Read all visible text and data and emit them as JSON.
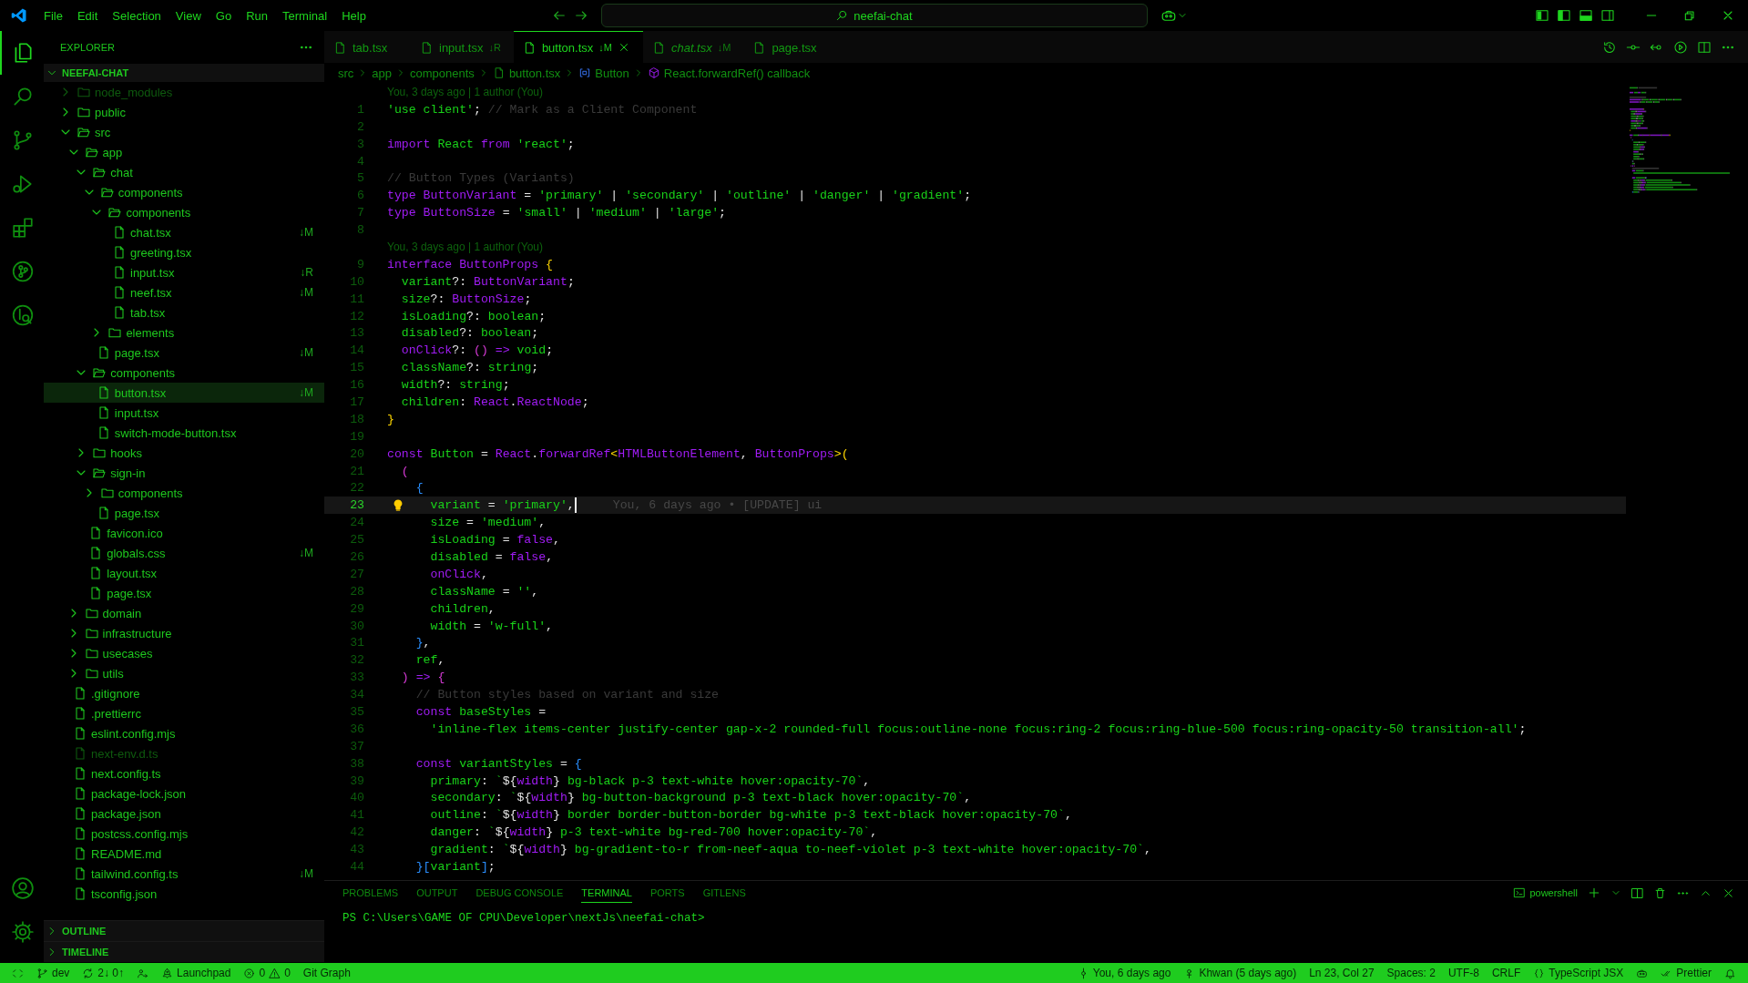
{
  "title_bar": {
    "menu": [
      "File",
      "Edit",
      "Selection",
      "View",
      "Go",
      "Run",
      "Terminal",
      "Help"
    ],
    "command_center": "neefai-chat"
  },
  "activity_bar": {
    "items": [
      {
        "kind": "explorer",
        "selected": true
      },
      {
        "kind": "search",
        "selected": false
      },
      {
        "kind": "source-control",
        "selected": false
      },
      {
        "kind": "run-debug",
        "selected": false
      },
      {
        "kind": "extensions",
        "selected": false
      },
      {
        "kind": "git-graph",
        "selected": false
      },
      {
        "kind": "inspect",
        "selected": false
      }
    ],
    "bottom": [
      {
        "kind": "account"
      },
      {
        "kind": "settings"
      }
    ]
  },
  "sidebar": {
    "title": "EXPLORER",
    "root": {
      "name": "NEEFAI-CHAT",
      "expanded": true,
      "children": [
        {
          "name": "node_modules",
          "kind": "folder",
          "expanded": false,
          "ignored": true,
          "selected": false
        },
        {
          "name": "public",
          "kind": "folder",
          "expanded": false,
          "ignored": false,
          "selected": false
        },
        {
          "name": "src",
          "kind": "folder",
          "expanded": true,
          "ignored": false,
          "selected": false,
          "children": [
            {
              "name": "app",
              "kind": "folder",
              "expanded": true,
              "ignored": false,
              "selected": false,
              "children": [
                {
                  "name": "chat",
                  "kind": "folder",
                  "expanded": true,
                  "ignored": false,
                  "selected": false,
                  "children": [
                    {
                      "name": "components",
                      "kind": "folder",
                      "expanded": true,
                      "ignored": false,
                      "selected": false,
                      "children": [
                        {
                          "name": "components",
                          "kind": "folder",
                          "expanded": true,
                          "ignored": false,
                          "selected": false,
                          "children": [
                            {
                              "name": "chat.tsx",
                              "kind": "file",
                              "ignored": false,
                              "selected": false,
                              "badge": "↓M"
                            },
                            {
                              "name": "greeting.tsx",
                              "kind": "file",
                              "ignored": false,
                              "selected": false
                            },
                            {
                              "name": "input.tsx",
                              "kind": "file",
                              "ignored": false,
                              "selected": false,
                              "badge": "↓R"
                            },
                            {
                              "name": "neef.tsx",
                              "kind": "file",
                              "ignored": false,
                              "selected": false,
                              "badge": "↓M"
                            },
                            {
                              "name": "tab.tsx",
                              "kind": "file",
                              "ignored": false,
                              "selected": false
                            }
                          ]
                        },
                        {
                          "name": "elements",
                          "kind": "folder",
                          "expanded": false,
                          "ignored": false,
                          "selected": false
                        }
                      ]
                    },
                    {
                      "name": "page.tsx",
                      "kind": "file",
                      "ignored": false,
                      "selected": false,
                      "badge": "↓M"
                    }
                  ]
                },
                {
                  "name": "components",
                  "kind": "folder",
                  "expanded": true,
                  "ignored": false,
                  "selected": false,
                  "children": [
                    {
                      "name": "button.tsx",
                      "kind": "file",
                      "ignored": false,
                      "selected": true,
                      "badge": "↓M"
                    },
                    {
                      "name": "input.tsx",
                      "kind": "file",
                      "ignored": false,
                      "selected": false
                    },
                    {
                      "name": "switch-mode-button.tsx",
                      "kind": "file",
                      "ignored": false,
                      "selected": false
                    }
                  ]
                },
                {
                  "name": "hooks",
                  "kind": "folder",
                  "expanded": false,
                  "ignored": false,
                  "selected": false
                },
                {
                  "name": "sign-in",
                  "kind": "folder",
                  "expanded": true,
                  "ignored": false,
                  "selected": false,
                  "children": [
                    {
                      "name": "components",
                      "kind": "folder",
                      "expanded": false,
                      "ignored": false,
                      "selected": false
                    },
                    {
                      "name": "page.tsx",
                      "kind": "file",
                      "ignored": false,
                      "selected": false
                    }
                  ]
                },
                {
                  "name": "favicon.ico",
                  "kind": "file",
                  "ignored": false,
                  "selected": false
                },
                {
                  "name": "globals.css",
                  "kind": "file",
                  "ignored": false,
                  "selected": false,
                  "badge": "↓M"
                },
                {
                  "name": "layout.tsx",
                  "kind": "file",
                  "ignored": false,
                  "selected": false
                },
                {
                  "name": "page.tsx",
                  "kind": "file",
                  "ignored": false,
                  "selected": false
                }
              ]
            },
            {
              "name": "domain",
              "kind": "folder",
              "expanded": false,
              "ignored": false,
              "selected": false
            },
            {
              "name": "infrastructure",
              "kind": "folder",
              "expanded": false,
              "ignored": false,
              "selected": false
            },
            {
              "name": "usecases",
              "kind": "folder",
              "expanded": false,
              "ignored": false,
              "selected": false
            },
            {
              "name": "utils",
              "kind": "folder",
              "expanded": false,
              "ignored": false,
              "selected": false
            }
          ]
        },
        {
          "name": ".gitignore",
          "kind": "file",
          "ignored": false,
          "selected": false
        },
        {
          "name": ".prettierrc",
          "kind": "file",
          "ignored": false,
          "selected": false
        },
        {
          "name": "eslint.config.mjs",
          "kind": "file",
          "ignored": false,
          "selected": false
        },
        {
          "name": "next-env.d.ts",
          "kind": "file",
          "ignored": true,
          "selected": false
        },
        {
          "name": "next.config.ts",
          "kind": "file",
          "ignored": false,
          "selected": false
        },
        {
          "name": "package-lock.json",
          "kind": "file",
          "ignored": false,
          "selected": false
        },
        {
          "name": "package.json",
          "kind": "file",
          "ignored": false,
          "selected": false
        },
        {
          "name": "postcss.config.mjs",
          "kind": "file",
          "ignored": false,
          "selected": false
        },
        {
          "name": "README.md",
          "kind": "file",
          "ignored": false,
          "selected": false
        },
        {
          "name": "tailwind.config.ts",
          "kind": "file",
          "ignored": false,
          "selected": false,
          "badge": "↓M"
        },
        {
          "name": "tsconfig.json",
          "kind": "file",
          "ignored": false,
          "selected": false
        }
      ]
    },
    "sections": [
      {
        "name": "OUTLINE",
        "expanded": false
      },
      {
        "name": "TIMELINE",
        "expanded": false
      }
    ]
  },
  "tabs": [
    {
      "label": "tab.tsx",
      "selected": false,
      "preview": false
    },
    {
      "label": "input.tsx",
      "selected": false,
      "preview": false,
      "badge": "↓R"
    },
    {
      "label": "button.tsx",
      "selected": true,
      "preview": false,
      "badge": "↓M"
    },
    {
      "label": "chat.tsx",
      "selected": false,
      "preview": true,
      "badge": "↓M"
    },
    {
      "label": "page.tsx",
      "selected": false,
      "preview": false
    }
  ],
  "breadcrumbs": [
    {
      "label": "src",
      "kind": "folder"
    },
    {
      "label": "app",
      "kind": "folder"
    },
    {
      "label": "components",
      "kind": "folder"
    },
    {
      "label": "button.tsx",
      "kind": "file"
    },
    {
      "label": "Button",
      "kind": "variable"
    },
    {
      "label": "React.forwardRef() callback",
      "kind": "method"
    }
  ],
  "editor": {
    "lines": [
      {
        "kind": "lens",
        "text": "You, 3 days ago | 1 author (You)"
      },
      {
        "kind": "code",
        "number": "1",
        "current": false,
        "tokens": [
          {
            "kind": "s",
            "text": "'use client'"
          },
          {
            "kind": "p",
            "text": ";"
          },
          {
            "kind": "c",
            "text": " // Mark as a Client Component"
          }
        ]
      },
      {
        "kind": "code",
        "number": "2",
        "current": false
      },
      {
        "kind": "code",
        "number": "3",
        "current": false,
        "tokens": [
          {
            "kind": "k",
            "text": "import"
          },
          {
            "kind": "t",
            "text": " React "
          },
          {
            "kind": "k",
            "text": "from"
          },
          {
            "kind": "s",
            "text": " 'react'"
          },
          {
            "kind": "p",
            "text": ";"
          }
        ]
      },
      {
        "kind": "code",
        "number": "4",
        "current": false
      },
      {
        "kind": "code",
        "number": "5",
        "current": false,
        "tokens": [
          {
            "kind": "c",
            "text": "// Button Types (Variants)"
          }
        ]
      },
      {
        "kind": "code",
        "number": "6",
        "current": false,
        "tokens": [
          {
            "kind": "k",
            "text": "type ButtonVariant"
          },
          {
            "kind": "p",
            "text": " = "
          },
          {
            "kind": "s",
            "text": "'primary'"
          },
          {
            "kind": "p",
            "text": " | "
          },
          {
            "kind": "s",
            "text": "'secondary'"
          },
          {
            "kind": "p",
            "text": " | "
          },
          {
            "kind": "s",
            "text": "'outline'"
          },
          {
            "kind": "p",
            "text": " | "
          },
          {
            "kind": "s",
            "text": "'danger'"
          },
          {
            "kind": "p",
            "text": " | "
          },
          {
            "kind": "s",
            "text": "'gradient'"
          },
          {
            "kind": "p",
            "text": ";"
          }
        ]
      },
      {
        "kind": "code",
        "number": "7",
        "current": false,
        "tokens": [
          {
            "kind": "k",
            "text": "type ButtonSize"
          },
          {
            "kind": "p",
            "text": " = "
          },
          {
            "kind": "s",
            "text": "'small'"
          },
          {
            "kind": "p",
            "text": " | "
          },
          {
            "kind": "s",
            "text": "'medium'"
          },
          {
            "kind": "p",
            "text": " | "
          },
          {
            "kind": "s",
            "text": "'large'"
          },
          {
            "kind": "p",
            "text": ";"
          }
        ]
      },
      {
        "kind": "code",
        "number": "8",
        "current": false
      },
      {
        "kind": "lens",
        "text": "You, 3 days ago | 1 author (You)"
      },
      {
        "kind": "code",
        "number": "9",
        "current": false,
        "tokens": [
          {
            "kind": "k",
            "text": "interface ButtonProps "
          },
          {
            "kind": "y",
            "text": "{"
          }
        ]
      },
      {
        "kind": "code",
        "number": "10",
        "current": false,
        "tokens": [
          {
            "kind": "t",
            "text": "  variant"
          },
          {
            "kind": "p",
            "text": "?: "
          },
          {
            "kind": "k",
            "text": "ButtonVariant"
          },
          {
            "kind": "p",
            "text": ";"
          }
        ]
      },
      {
        "kind": "code",
        "number": "11",
        "current": false,
        "tokens": [
          {
            "kind": "t",
            "text": "  size"
          },
          {
            "kind": "p",
            "text": "?: "
          },
          {
            "kind": "k",
            "text": "ButtonSize"
          },
          {
            "kind": "p",
            "text": ";"
          }
        ]
      },
      {
        "kind": "code",
        "number": "12",
        "current": false,
        "tokens": [
          {
            "kind": "t",
            "text": "  isLoading"
          },
          {
            "kind": "p",
            "text": "?: "
          },
          {
            "kind": "t",
            "text": "boolean"
          },
          {
            "kind": "p",
            "text": ";"
          }
        ]
      },
      {
        "kind": "code",
        "number": "13",
        "current": false,
        "tokens": [
          {
            "kind": "t",
            "text": "  disabled"
          },
          {
            "kind": "p",
            "text": "?: "
          },
          {
            "kind": "t",
            "text": "boolean"
          },
          {
            "kind": "p",
            "text": ";"
          }
        ]
      },
      {
        "kind": "code",
        "number": "14",
        "current": false,
        "tokens": [
          {
            "kind": "k",
            "text": "  onClick"
          },
          {
            "kind": "p",
            "text": "?: "
          },
          {
            "kind": "m",
            "text": "()"
          },
          {
            "kind": "k",
            "text": " =>"
          },
          {
            "kind": "t",
            "text": " void"
          },
          {
            "kind": "p",
            "text": ";"
          }
        ]
      },
      {
        "kind": "code",
        "number": "15",
        "current": false,
        "tokens": [
          {
            "kind": "t",
            "text": "  className"
          },
          {
            "kind": "p",
            "text": "?: "
          },
          {
            "kind": "t",
            "text": "string"
          },
          {
            "kind": "p",
            "text": ";"
          }
        ]
      },
      {
        "kind": "code",
        "number": "16",
        "current": false,
        "tokens": [
          {
            "kind": "t",
            "text": "  width"
          },
          {
            "kind": "p",
            "text": "?: "
          },
          {
            "kind": "t",
            "text": "string"
          },
          {
            "kind": "p",
            "text": ";"
          }
        ]
      },
      {
        "kind": "code",
        "number": "17",
        "current": false,
        "tokens": [
          {
            "kind": "t",
            "text": "  children"
          },
          {
            "kind": "p",
            "text": ": "
          },
          {
            "kind": "k",
            "text": "React"
          },
          {
            "kind": "p",
            "text": "."
          },
          {
            "kind": "k",
            "text": "ReactNode"
          },
          {
            "kind": "p",
            "text": ";"
          }
        ]
      },
      {
        "kind": "code",
        "number": "18",
        "current": false,
        "tokens": [
          {
            "kind": "y",
            "text": "}"
          }
        ]
      },
      {
        "kind": "code",
        "number": "19",
        "current": false
      },
      {
        "kind": "code",
        "number": "20",
        "current": false,
        "tokens": [
          {
            "kind": "k",
            "text": "const"
          },
          {
            "kind": "t",
            "text": " Button "
          },
          {
            "kind": "p",
            "text": "= "
          },
          {
            "kind": "k",
            "text": "React"
          },
          {
            "kind": "p",
            "text": "."
          },
          {
            "kind": "k",
            "text": "forwardRef"
          },
          {
            "kind": "y",
            "text": "<"
          },
          {
            "kind": "k",
            "text": "HTMLButtonElement"
          },
          {
            "kind": "p",
            "text": ", "
          },
          {
            "kind": "k",
            "text": "ButtonProps"
          },
          {
            "kind": "y",
            "text": ">("
          }
        ]
      },
      {
        "kind": "code",
        "number": "21",
        "current": false,
        "tokens": [
          {
            "kind": "m",
            "text": "  ("
          }
        ]
      },
      {
        "kind": "code",
        "number": "22",
        "current": false,
        "tokens": [
          {
            "kind": "b",
            "text": "    {"
          }
        ]
      },
      {
        "kind": "code",
        "number": "23",
        "current": true,
        "blame": "You, 6 days ago • [UPDATE] ui",
        "tokens": [
          {
            "kind": "t",
            "text": "      variant "
          },
          {
            "kind": "p",
            "text": "= "
          },
          {
            "kind": "s",
            "text": "'primary'"
          },
          {
            "kind": "p",
            "text": ","
          }
        ]
      },
      {
        "kind": "code",
        "number": "24",
        "current": false,
        "tokens": [
          {
            "kind": "t",
            "text": "      size "
          },
          {
            "kind": "p",
            "text": "= "
          },
          {
            "kind": "s",
            "text": "'medium'"
          },
          {
            "kind": "p",
            "text": ","
          }
        ]
      },
      {
        "kind": "code",
        "number": "25",
        "current": false,
        "tokens": [
          {
            "kind": "t",
            "text": "      isLoading "
          },
          {
            "kind": "p",
            "text": "= "
          },
          {
            "kind": "k",
            "text": "false"
          },
          {
            "kind": "p",
            "text": ","
          }
        ]
      },
      {
        "kind": "code",
        "number": "26",
        "current": false,
        "tokens": [
          {
            "kind": "t",
            "text": "      disabled "
          },
          {
            "kind": "p",
            "text": "= "
          },
          {
            "kind": "k",
            "text": "false"
          },
          {
            "kind": "p",
            "text": ","
          }
        ]
      },
      {
        "kind": "code",
        "number": "27",
        "current": false,
        "tokens": [
          {
            "kind": "k",
            "text": "      onClick"
          },
          {
            "kind": "p",
            "text": ","
          }
        ]
      },
      {
        "kind": "code",
        "number": "28",
        "current": false,
        "tokens": [
          {
            "kind": "t",
            "text": "      className "
          },
          {
            "kind": "p",
            "text": "= "
          },
          {
            "kind": "s",
            "text": "''"
          },
          {
            "kind": "p",
            "text": ","
          }
        ]
      },
      {
        "kind": "code",
        "number": "29",
        "current": false,
        "tokens": [
          {
            "kind": "t",
            "text": "      children"
          },
          {
            "kind": "p",
            "text": ","
          }
        ]
      },
      {
        "kind": "code",
        "number": "30",
        "current": false,
        "tokens": [
          {
            "kind": "t",
            "text": "      width "
          },
          {
            "kind": "p",
            "text": "= "
          },
          {
            "kind": "s",
            "text": "'w-full'"
          },
          {
            "kind": "p",
            "text": ","
          }
        ]
      },
      {
        "kind": "code",
        "number": "31",
        "current": false,
        "tokens": [
          {
            "kind": "b",
            "text": "    }"
          },
          {
            "kind": "p",
            "text": ","
          }
        ]
      },
      {
        "kind": "code",
        "number": "32",
        "current": false,
        "tokens": [
          {
            "kind": "t",
            "text": "    ref"
          },
          {
            "kind": "p",
            "text": ","
          }
        ]
      },
      {
        "kind": "code",
        "number": "33",
        "current": false,
        "tokens": [
          {
            "kind": "m",
            "text": "  )"
          },
          {
            "kind": "k",
            "text": " =>"
          },
          {
            "kind": "m",
            "text": " {"
          }
        ]
      },
      {
        "kind": "code",
        "number": "34",
        "current": false,
        "tokens": [
          {
            "kind": "c",
            "text": "    // Button styles based on variant and size"
          }
        ]
      },
      {
        "kind": "code",
        "number": "35",
        "current": false,
        "tokens": [
          {
            "kind": "k",
            "text": "    const"
          },
          {
            "kind": "t",
            "text": " baseStyles "
          },
          {
            "kind": "p",
            "text": "="
          }
        ]
      },
      {
        "kind": "code",
        "number": "36",
        "current": false,
        "tokens": [
          {
            "kind": "s",
            "text": "      'inline-flex items-center justify-center gap-x-2 rounded-full focus:outline-none focus:ring-2 focus:ring-blue-500 focus:ring-opacity-50 transition-all'"
          },
          {
            "kind": "p",
            "text": ";"
          }
        ]
      },
      {
        "kind": "code",
        "number": "37",
        "current": false
      },
      {
        "kind": "code",
        "number": "38",
        "current": false,
        "tokens": [
          {
            "kind": "k",
            "text": "    const"
          },
          {
            "kind": "t",
            "text": " variantStyles "
          },
          {
            "kind": "p",
            "text": "= "
          },
          {
            "kind": "b",
            "text": "{"
          }
        ]
      },
      {
        "kind": "code",
        "number": "39",
        "current": false,
        "tokens": [
          {
            "kind": "t",
            "text": "      primary"
          },
          {
            "kind": "p",
            "text": ": "
          },
          {
            "kind": "s",
            "text": "`"
          },
          {
            "kind": "p",
            "text": "${"
          },
          {
            "kind": "k",
            "text": "width"
          },
          {
            "kind": "p",
            "text": "}"
          },
          {
            "kind": "s",
            "text": " bg-black p-3 text-white hover:opacity-70`"
          },
          {
            "kind": "p",
            "text": ","
          }
        ]
      },
      {
        "kind": "code",
        "number": "40",
        "current": false,
        "tokens": [
          {
            "kind": "t",
            "text": "      secondary"
          },
          {
            "kind": "p",
            "text": ": "
          },
          {
            "kind": "s",
            "text": "`"
          },
          {
            "kind": "p",
            "text": "${"
          },
          {
            "kind": "k",
            "text": "width"
          },
          {
            "kind": "p",
            "text": "}"
          },
          {
            "kind": "s",
            "text": " bg-button-background p-3 text-black hover:opacity-70`"
          },
          {
            "kind": "p",
            "text": ","
          }
        ]
      },
      {
        "kind": "code",
        "number": "41",
        "current": false,
        "tokens": [
          {
            "kind": "t",
            "text": "      outline"
          },
          {
            "kind": "p",
            "text": ": "
          },
          {
            "kind": "s",
            "text": "`"
          },
          {
            "kind": "p",
            "text": "${"
          },
          {
            "kind": "k",
            "text": "width"
          },
          {
            "kind": "p",
            "text": "}"
          },
          {
            "kind": "s",
            "text": " border border-button-border bg-white p-3 text-black hover:opacity-70`"
          },
          {
            "kind": "p",
            "text": ","
          }
        ]
      },
      {
        "kind": "code",
        "number": "42",
        "current": false,
        "tokens": [
          {
            "kind": "t",
            "text": "      danger"
          },
          {
            "kind": "p",
            "text": ": "
          },
          {
            "kind": "s",
            "text": "`"
          },
          {
            "kind": "p",
            "text": "${"
          },
          {
            "kind": "k",
            "text": "width"
          },
          {
            "kind": "p",
            "text": "}"
          },
          {
            "kind": "s",
            "text": " p-3 text-white bg-red-700 hover:opacity-70`"
          },
          {
            "kind": "p",
            "text": ","
          }
        ]
      },
      {
        "kind": "code",
        "number": "43",
        "current": false,
        "tokens": [
          {
            "kind": "t",
            "text": "      gradient"
          },
          {
            "kind": "p",
            "text": ": "
          },
          {
            "kind": "s",
            "text": "`"
          },
          {
            "kind": "p",
            "text": "${"
          },
          {
            "kind": "k",
            "text": "width"
          },
          {
            "kind": "p",
            "text": "}"
          },
          {
            "kind": "s",
            "text": " bg-gradient-to-r from-neef-aqua to-neef-violet p-3 text-white hover:opacity-70`"
          },
          {
            "kind": "p",
            "text": ","
          }
        ]
      },
      {
        "kind": "code",
        "number": "44",
        "current": false,
        "tokens": [
          {
            "kind": "b",
            "text": "    }["
          },
          {
            "kind": "t",
            "text": "variant"
          },
          {
            "kind": "b",
            "text": "]"
          },
          {
            "kind": "p",
            "text": ";"
          }
        ]
      }
    ]
  },
  "panel": {
    "tabs": [
      {
        "label": "PROBLEMS",
        "selected": false
      },
      {
        "label": "OUTPUT",
        "selected": false
      },
      {
        "label": "DEBUG CONSOLE",
        "selected": false
      },
      {
        "label": "TERMINAL",
        "selected": true
      },
      {
        "label": "PORTS",
        "selected": false
      },
      {
        "label": "GITLENS",
        "selected": false
      }
    ],
    "terminal_name": "powershell",
    "terminal_lines": [
      "PS C:\\Users\\GAME OF CPU\\Developer\\nextJs\\neefai-chat>"
    ]
  },
  "status_bar": {
    "left": [
      {
        "kind": "remote"
      },
      {
        "kind": "branch",
        "text": "dev"
      },
      {
        "kind": "sync",
        "text": "2↓ 0↑"
      },
      {
        "kind": "liveshare"
      },
      {
        "kind": "launchpad",
        "text": "Launchpad"
      },
      {
        "kind": "problems",
        "errors": "0",
        "warnings": "0"
      },
      {
        "kind": "plain",
        "text": "Git Graph"
      }
    ],
    "right": [
      {
        "kind": "commit",
        "text": "You, 6 days ago"
      },
      {
        "kind": "author",
        "text": "Khwan (5 days ago)"
      },
      {
        "kind": "plain",
        "text": "Ln 23, Col 27"
      },
      {
        "kind": "plain",
        "text": "Spaces: 2"
      },
      {
        "kind": "plain",
        "text": "UTF-8"
      },
      {
        "kind": "plain",
        "text": "CRLF"
      },
      {
        "kind": "language",
        "text": "TypeScript JSX"
      },
      {
        "kind": "copilot"
      },
      {
        "kind": "prettier",
        "text": "Prettier"
      },
      {
        "kind": "bell"
      }
    ]
  }
}
